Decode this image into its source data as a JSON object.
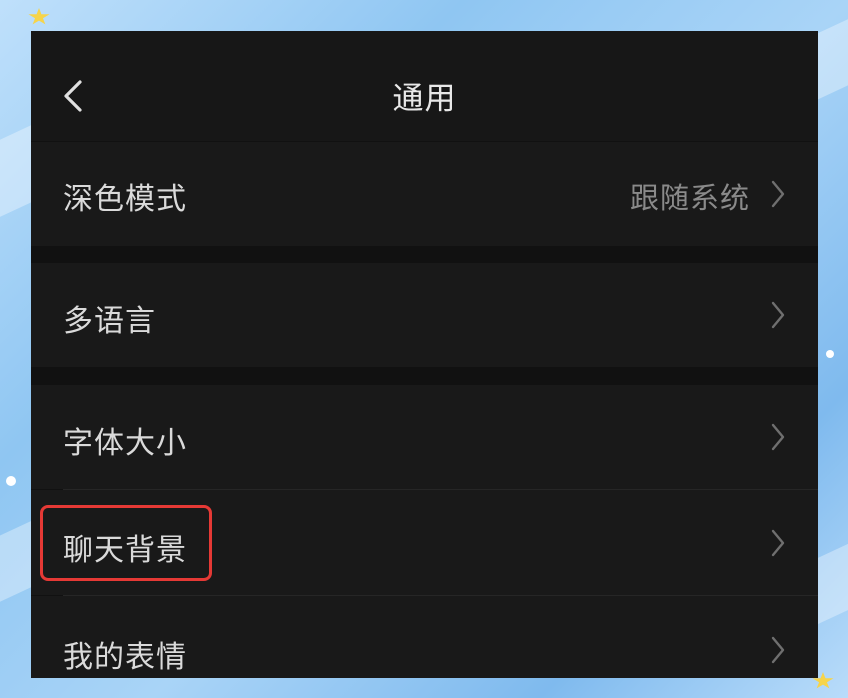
{
  "header": {
    "title": "通用"
  },
  "settings": {
    "dark_mode": {
      "label": "深色模式",
      "value": "跟随系统"
    },
    "language": {
      "label": "多语言"
    },
    "font_size": {
      "label": "字体大小"
    },
    "chat_background": {
      "label": "聊天背景"
    },
    "my_stickers": {
      "label": "我的表情"
    }
  },
  "colors": {
    "highlight_border": "#e53935",
    "screen_background": "#111111",
    "row_background": "#191919"
  },
  "icons": {
    "back": "chevron-left-icon",
    "row_arrow": "chevron-right-icon"
  }
}
